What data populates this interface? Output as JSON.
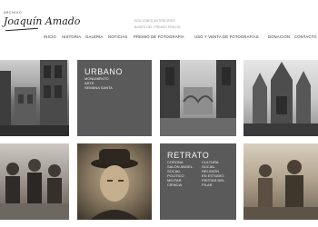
{
  "brand": {
    "small": "ARCHIVO",
    "script": "Joaquín Amado"
  },
  "subnav": [
    "EDICIONES ANTERIORES",
    "BASES DEL PREMIO PREVIO"
  ],
  "nav": [
    {
      "label": "INICIO"
    },
    {
      "label": "HISTORIA"
    },
    {
      "label": "GALERÍA"
    },
    {
      "label": "NOTICIAS"
    },
    {
      "label": "PREMIO DE FOTOGRAFÍA"
    },
    {
      "label": "USO Y VENTA DE FOTOGRAFÍAS"
    },
    {
      "label": "DONACIÓN"
    },
    {
      "label": "CONTACTO"
    }
  ],
  "gallery": {
    "urbano": {
      "title": "URBANO",
      "items": [
        "MONUMENTO",
        "ARTE",
        "SEMANA SANTA"
      ]
    },
    "retrato": {
      "title": "RETRATO",
      "col1": [
        "CORONA",
        "SALÓN ANGEL",
        "SOCIAL",
        "POLÍTICO",
        "MILITAR",
        "CIENCIA"
      ],
      "col2": [
        "CULTURA",
        "SOCIAL",
        "RELIGIÓN",
        "EN ESTUDIO",
        "FIESTAS DEL",
        "PILAR"
      ]
    }
  }
}
